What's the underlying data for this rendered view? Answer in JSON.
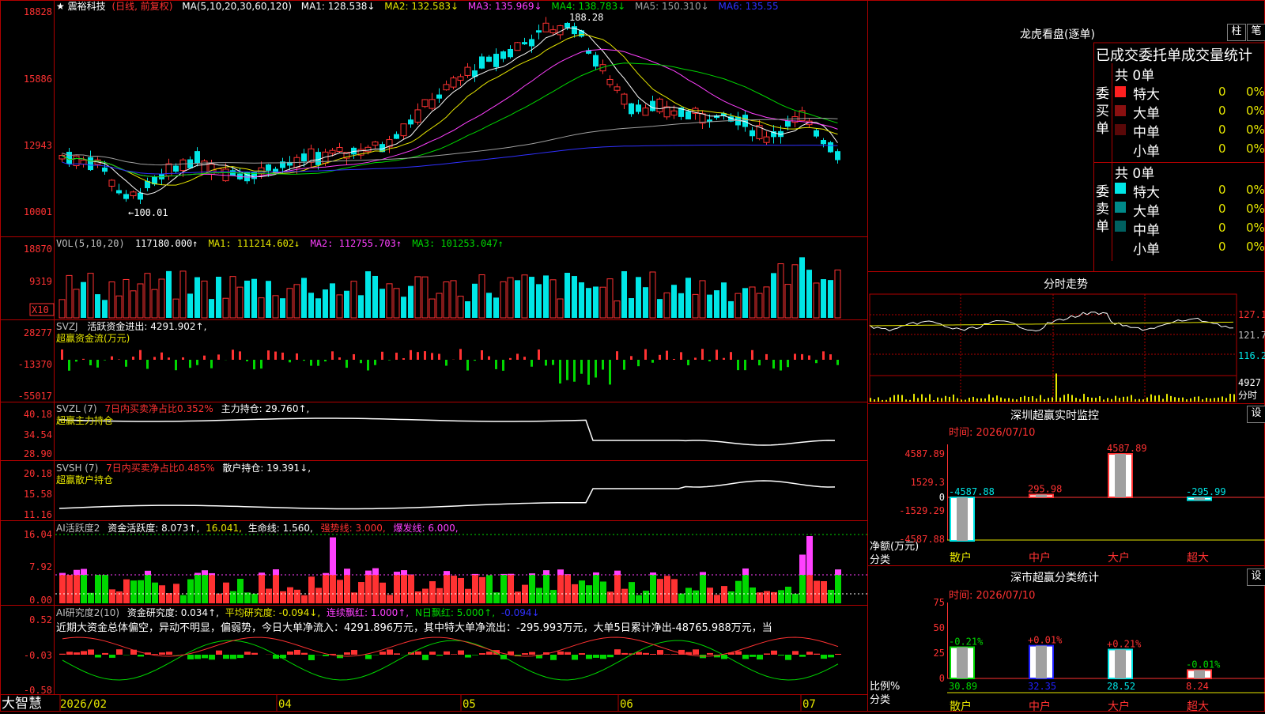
{
  "app": {
    "brand": "大智慧"
  },
  "colors": {
    "up": "#ff3232",
    "down": "#00e6e6",
    "grid": "#b00000",
    "yellow": "#e6e600",
    "magenta": "#ff40ff",
    "green": "#00d800",
    "white": "#ffffff",
    "blue": "#3030ff",
    "gray": "#a0a0a0",
    "label": "#c0c0c0"
  },
  "price_panel": {
    "prefix": "★",
    "stock_name": "震裕科技",
    "period": "(日线, 前复权)",
    "ma_header": "MA(5,10,20,30,60,120)",
    "ma_values": [
      "MA1: 128.538↓",
      "MA2: 132.583↓",
      "MA3: 135.969↓",
      "MA4: 138.783↓",
      "MA5: 150.310↓",
      "MA6: 135.55"
    ],
    "y_ticks": [
      "18828",
      "15886",
      "12943",
      "10001"
    ],
    "high_label": "188.28",
    "low_label": "←100.01"
  },
  "vol_panel": {
    "header": [
      "VOL(5,10,20)",
      "117180.000↑",
      "MA1: 111214.602↓",
      "MA2: 112755.703↑",
      "MA3: 101253.047↑"
    ],
    "y_ticks": [
      "18870",
      "9319"
    ],
    "unit": "X10"
  },
  "svzj_panel": {
    "header": [
      "SVZJ",
      "活跃资金进出: 4291.902↑,"
    ],
    "subtitle": "超赢资金流(万元)",
    "y_ticks": [
      "28277",
      "-13370",
      "-55017"
    ]
  },
  "svzl_panel": {
    "header": [
      "SVZL (7)",
      "7日内买卖净占比0.352%",
      "主力持仓: 29.760↑,"
    ],
    "subtitle": "超赢主力持仓",
    "y_ticks": [
      "40.18",
      "34.54",
      "28.90"
    ]
  },
  "svsh_panel": {
    "header": [
      "SVSH (7)",
      "7日内买卖净占比0.485%",
      "散户持仓: 19.391↓,"
    ],
    "subtitle": "超赢散户持仓",
    "y_ticks": [
      "20.18",
      "15.58",
      "11.16"
    ]
  },
  "ai_active_panel": {
    "header": [
      "AI活跃度2",
      "资金活跃度: 8.073↑,",
      "16.041,",
      "生命线: 1.560,",
      "强势线: 3.000,",
      "爆发线: 6.000,"
    ],
    "y_ticks": [
      "16.04",
      "7.92",
      "0.00"
    ]
  },
  "ai_research_panel": {
    "header": [
      "AI研究度2(10)",
      "资金研究度: 0.034↑,",
      "平均研究度: -0.094↓,",
      "连续飘红: 1.000↑,",
      "N日飘红: 5.000↑,",
      "-0.094↓"
    ],
    "commentary": "近期大资金总体偏空，异动不明显，偏弱势，今日大单净流入：4291.896万元，其中特大单净流出：-295.993万元，大单5日累计净出-48765.988万元，当",
    "y_ticks": [
      "0.52",
      "-0.03",
      "-0.58"
    ]
  },
  "x_axis": {
    "labels": [
      "2026/02",
      "04",
      "05",
      "06",
      "07"
    ]
  },
  "dragon_tiger": {
    "title": "龙虎看盘(逐单)",
    "btn_bar": "柱",
    "btn_pen": "笔",
    "header": "已成交委托单成交量统计",
    "buy_label": "委买单",
    "sell_label": "委卖单",
    "buy_total": "共 0单",
    "sell_total": "共 0单",
    "rows": [
      {
        "label": "特大",
        "count": "0",
        "pct": "0%"
      },
      {
        "label": "大单",
        "count": "0",
        "pct": "0%"
      },
      {
        "label": "中单",
        "count": "0",
        "pct": "0%"
      },
      {
        "label": "小单",
        "count": "0",
        "pct": "0%"
      }
    ]
  },
  "intraday": {
    "title": "分时走势",
    "price_ticks": [
      "127.1",
      "121.7",
      "116.2"
    ],
    "vol_tick": "4927",
    "vol_unit": "分时"
  },
  "sz_monitor": {
    "title": "深圳超赢实时监控",
    "btn_set": "设",
    "time": "时间: 2026/07/10",
    "y_ticks": [
      "4587.89",
      "1529.3",
      "0",
      "-1529.29",
      "-4587.88"
    ],
    "axis_label": "净额(万元)",
    "axis_label2": "分类",
    "categories": [
      "散户",
      "中户",
      "大户",
      "超大"
    ],
    "bars": [
      {
        "value": -4587.88,
        "label": "-4587.88"
      },
      {
        "value": 295.98,
        "label": "295.98"
      },
      {
        "value": 4587.89,
        "label": "4587.89"
      },
      {
        "value": -295.99,
        "label": "-295.99"
      }
    ]
  },
  "sz_stats": {
    "title": "深市超赢分类统计",
    "btn_set": "设",
    "time": "时间: 2026/07/10",
    "y_ticks": [
      "75",
      "50",
      "25",
      "0"
    ],
    "axis_label": "比例%",
    "axis_label2": "分类",
    "categories": [
      "散户",
      "中户",
      "大户",
      "超大"
    ],
    "bars": [
      {
        "value": 30.89,
        "label": "30.89",
        "delta": "-0.21%"
      },
      {
        "value": 32.35,
        "label": "32.35",
        "delta": "+0.01%"
      },
      {
        "value": 28.52,
        "label": "28.52",
        "delta": "+0.21%"
      },
      {
        "value": 8.24,
        "label": "8.24",
        "delta": "-0.01%"
      }
    ]
  }
}
